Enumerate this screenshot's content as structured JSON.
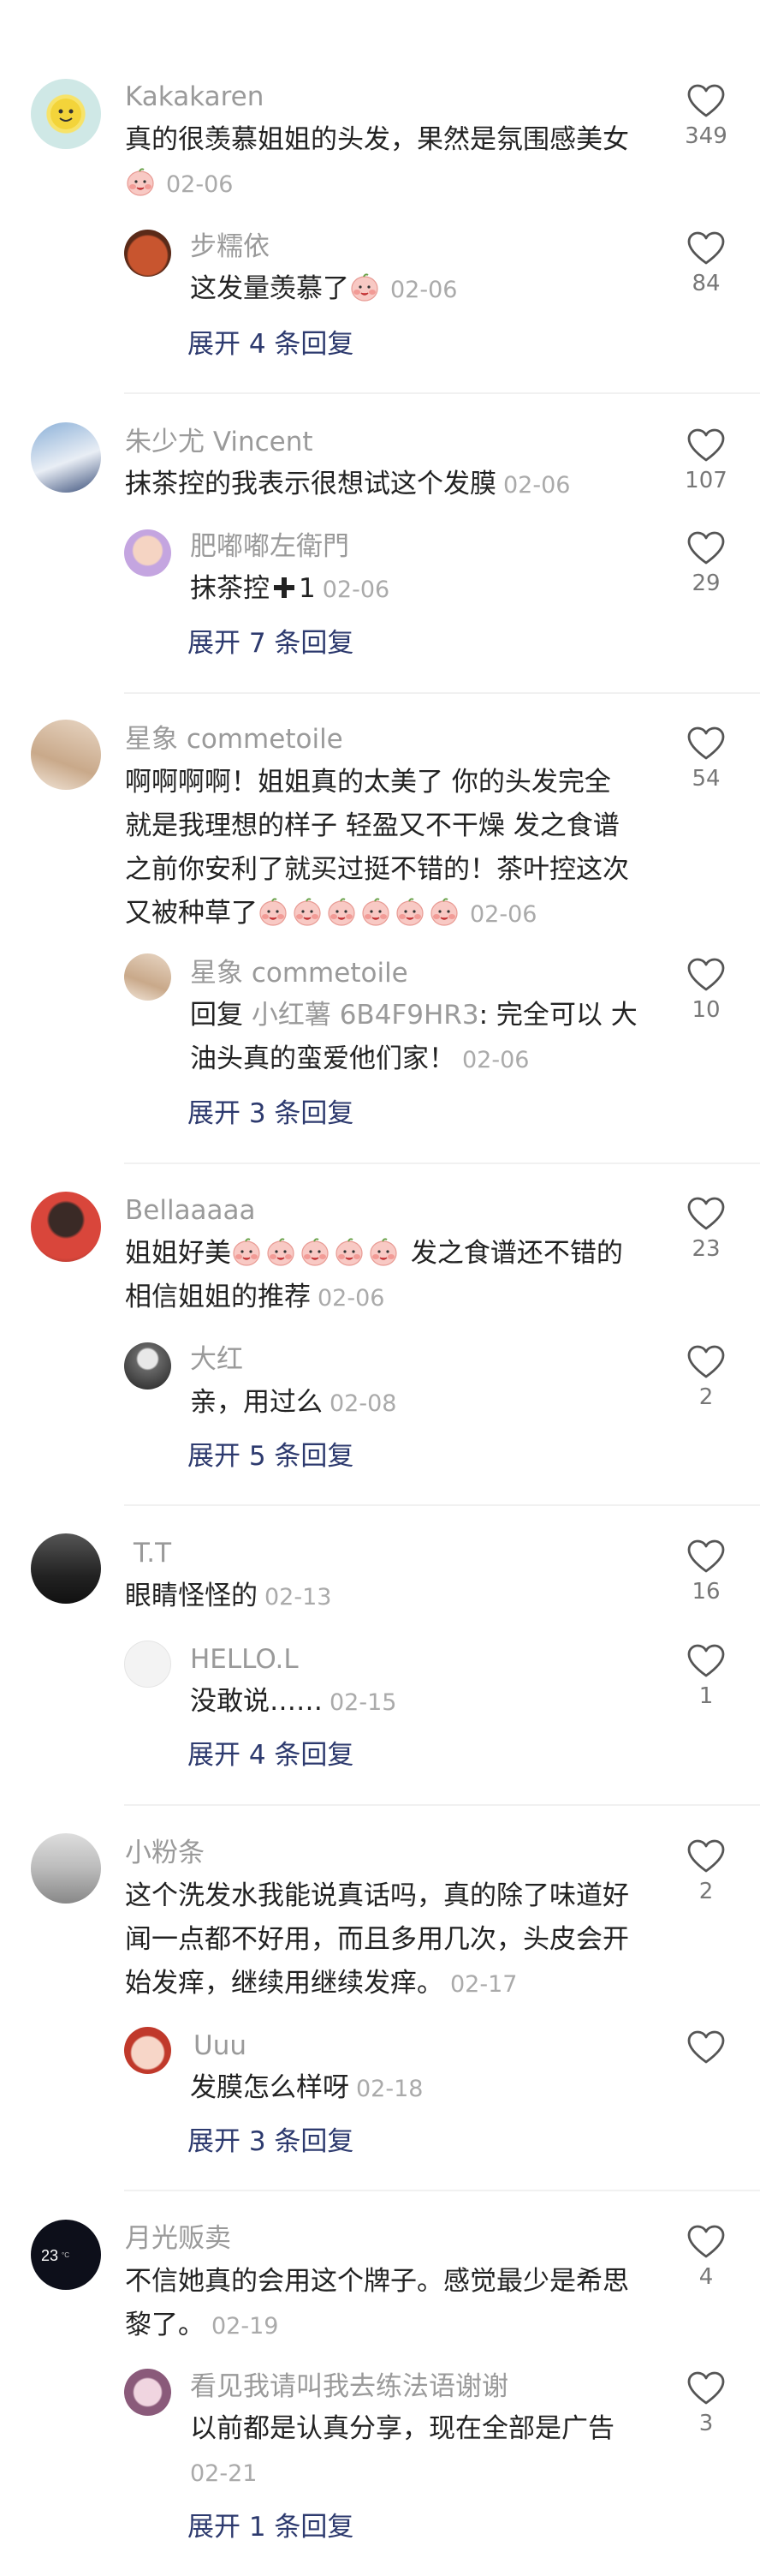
{
  "colors": {
    "name": "#9a9a9a",
    "text": "#222222",
    "time": "#aaaaaa",
    "expand": "#2d3a6e",
    "divider": "#f1f1f1"
  },
  "threads": [
    {
      "main": {
        "name": "Kakakaren",
        "text": "真的很羡慕姐姐的头发，果然是氛围感美女",
        "time": "02-06",
        "likes": "349"
      },
      "reply": {
        "name": "步糯依",
        "text": "这发量羡慕了",
        "time": "02-06",
        "likes": "84"
      },
      "expand": "展开 4 条回复"
    },
    {
      "main": {
        "name": "朱少尤 Vincent",
        "text": "抹茶控的我表示很想试这个发膜",
        "time": "02-06",
        "likes": "107"
      },
      "reply": {
        "name": "肥嘟嘟左衛門",
        "text": "抹茶控",
        "suffix": "1",
        "time": "02-06",
        "likes": "29"
      },
      "expand": "展开 7 条回复"
    },
    {
      "main": {
        "name": "星象 commetoile",
        "text_line1": "啊啊啊啊！姐姐真的太美了 你的头发完全",
        "text_line2": "就是我理想的样子 轻盈又不干燥 发之食谱",
        "text_line3": "之前你安利了就买过挺不错的！茶叶控这次",
        "text_line4": "又被种草了",
        "time": "02-06",
        "likes": "54"
      },
      "reply": {
        "name": "星象 commetoile",
        "prefix": "回复",
        "mention": "小红薯 6B4F9HR3",
        "text_line1": ": 完全可以 大",
        "text_line2": "油头真的蛮爱他们家！",
        "time": "02-06",
        "likes": "10"
      },
      "expand": "展开 3 条回复"
    },
    {
      "main": {
        "name": "Bellaaaaa",
        "text_a": "姐姐好美",
        "text_b": " 发之食谱还不错的",
        "text_line2": "相信姐姐的推荐",
        "time": "02-06",
        "likes": "23"
      },
      "reply": {
        "name": "大红",
        "text": "亲，用过么",
        "time": "02-08",
        "likes": "2"
      },
      "expand": "展开 5 条回复"
    },
    {
      "main": {
        "name": "T.T",
        "text": "眼睛怪怪的",
        "time": "02-13",
        "likes": "16"
      },
      "reply": {
        "name": "HELLO.L",
        "text": "没敢说……",
        "time": "02-15",
        "likes": "1"
      },
      "expand": "展开 4 条回复"
    },
    {
      "main": {
        "name": "小粉条",
        "text_line1": "这个洗发水我能说真话吗，真的除了味道好",
        "text_line2": "闻一点都不好用，而且多用几次，头皮会开",
        "text_line3": "始发痒，继续用继续发痒。",
        "time": "02-17",
        "likes": "2"
      },
      "reply": {
        "name": "Uuu",
        "text": "发膜怎么样呀",
        "time": "02-18",
        "likes": ""
      },
      "expand": "展开 3 条回复"
    },
    {
      "main": {
        "name": "月光贩卖",
        "text_line1": "不信她真的会用这个牌子。感觉最少是希思",
        "text_line2": "黎了。",
        "time": "02-19",
        "likes": "4"
      },
      "reply": {
        "name": "看见我请叫我去练法语谢谢",
        "text": "以前都是认真分享，现在全部是广告",
        "time": "02-21",
        "likes": "3"
      },
      "expand": "展开 1 条回复"
    }
  ]
}
